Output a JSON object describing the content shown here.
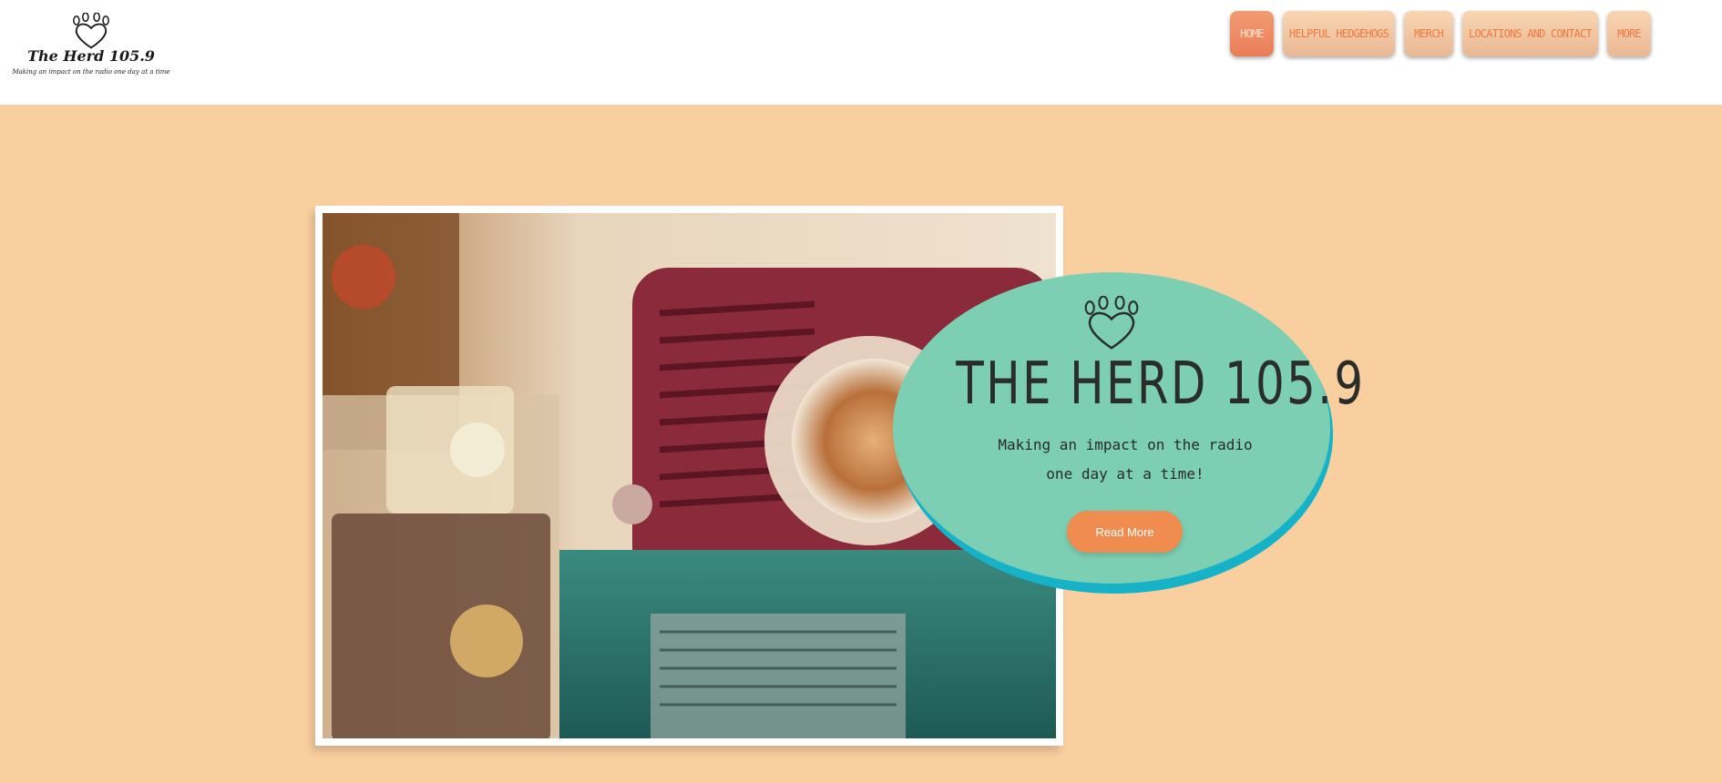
{
  "logo": {
    "name": "The Herd 105.9",
    "tagline": "Making an impact on the radio one day at a time",
    "icon": "paw-heart-icon"
  },
  "nav": {
    "items": [
      {
        "label": "HOME",
        "active": true
      },
      {
        "label": "HELPFUL HEDGEHOGS",
        "active": false
      },
      {
        "label": "MERCH",
        "active": false
      },
      {
        "label": "LOCATIONS AND CONTACT",
        "active": false
      },
      {
        "label": "MORE",
        "active": false
      }
    ]
  },
  "hero": {
    "icon": "paw-heart-icon",
    "title": "THE HERD 105.9",
    "subtitle_line1": "Making an impact on the radio",
    "subtitle_line2": "one day at a time!",
    "cta_label": "Read More"
  },
  "colors": {
    "hero_background": "#f9cf9f",
    "oval": "#7ccfb2",
    "oval_shadow": "#16b3c8",
    "nav_text": "#f07a3c",
    "cta": "#f08c50"
  }
}
